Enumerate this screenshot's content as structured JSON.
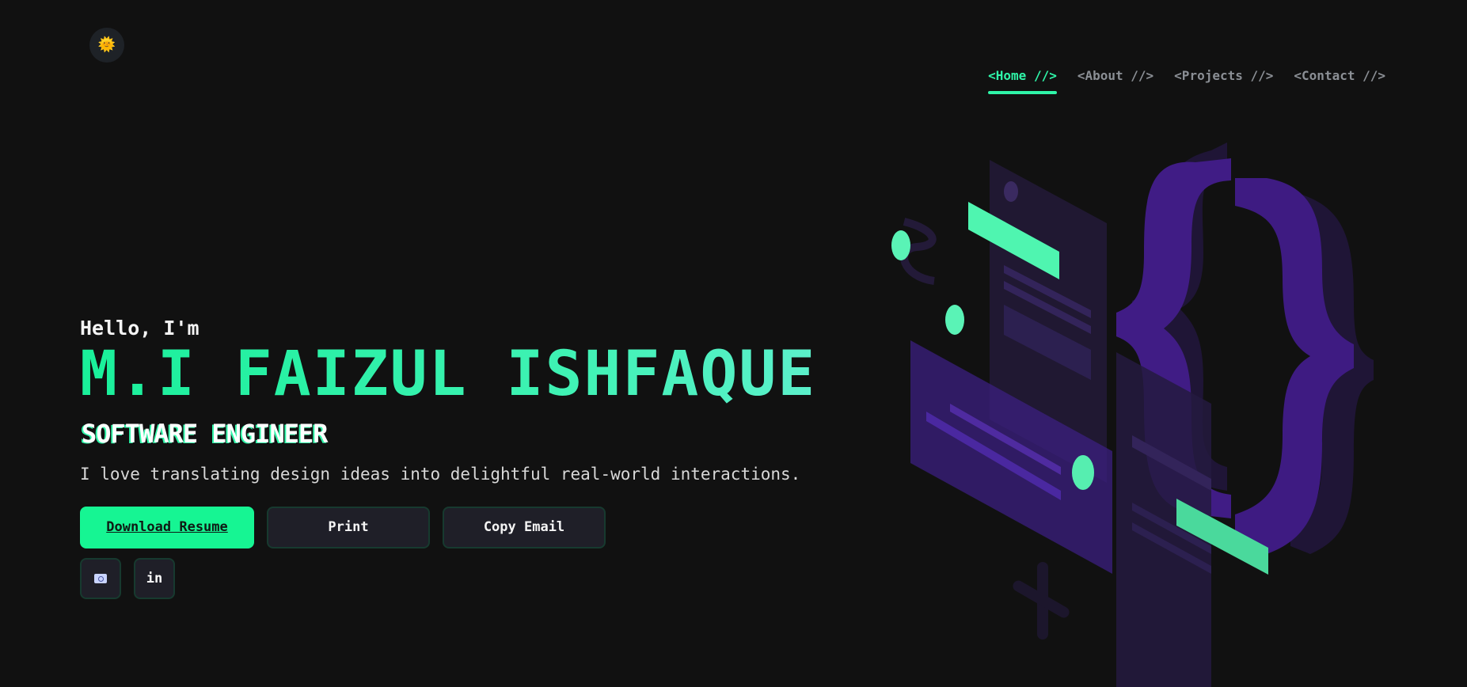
{
  "logo": {
    "icon": "sun-icon",
    "glyph": "🌞"
  },
  "nav": {
    "items": [
      {
        "label": "<Home //>",
        "active": true
      },
      {
        "label": "<About //>",
        "active": false
      },
      {
        "label": "<Projects //>",
        "active": false
      },
      {
        "label": "<Contact //>",
        "active": false
      }
    ]
  },
  "hero": {
    "greeting": "Hello, I'm",
    "name": "M.I FAIZUL ISHFAQUE",
    "role": "SOFTWARE ENGINEER",
    "tagline": "I love translating design ideas into delightful real-world interactions."
  },
  "actions": {
    "download": "Download Resume",
    "print": "Print",
    "copy_email": "Copy Email"
  },
  "social": {
    "email_icon": "email-icon",
    "linkedin_label": "in"
  },
  "colors": {
    "background": "#111111",
    "accent": "#2ff5a8",
    "primary_button": "#16f593",
    "illustration_purple": "#4a1f9e"
  }
}
